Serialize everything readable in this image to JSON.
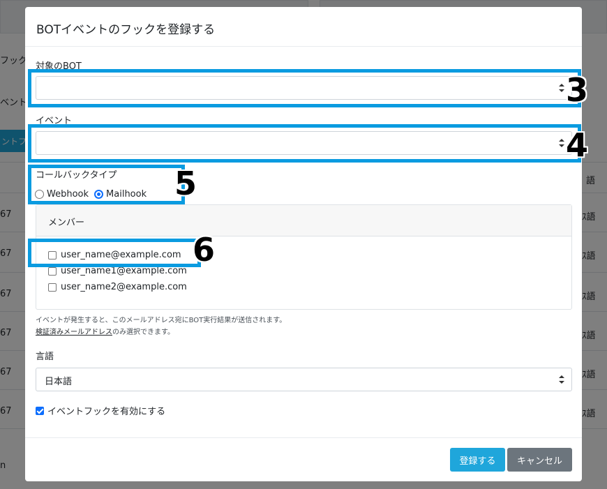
{
  "background": {
    "left_fragments": [
      "フック",
      "ベント",
      "ントフ",
      "67",
      "67",
      "67",
      "67",
      "67",
      "67",
      "n"
    ],
    "right_fragments": [
      "語",
      "ｽ語",
      "ｽ語",
      "ｽ語",
      "ｽ語",
      "ｽ語",
      "ｽ語"
    ]
  },
  "modal": {
    "title": "BOTイベントのフックを登録する",
    "target_bot_label": "対象のBOT",
    "target_bot_value": "",
    "event_label": "イベント",
    "event_value": "",
    "callback_type_label": "コールバックタイプ",
    "callback_options": [
      {
        "label": "Webhook",
        "selected": false
      },
      {
        "label": "Mailhook",
        "selected": true
      }
    ],
    "members_header": "メンバー",
    "members": [
      {
        "email": "user_name@example.com",
        "checked": false
      },
      {
        "email": "user_name1@example.com",
        "checked": false
      },
      {
        "email": "user_name2@example.com",
        "checked": false
      }
    ],
    "help_line1": "イベントが発生すると、このメールアドレス宛にBOT実行結果が送信されます。",
    "help_link": "検証済みメールアドレス",
    "help_line2_suffix": "のみ選択できます。",
    "language_label": "言語",
    "language_value": "日本語",
    "enable_label": "イベントフックを有効にする",
    "enable_checked": true,
    "submit_label": "登録する",
    "cancel_label": "キャンセル"
  },
  "annotations": [
    "3",
    "4",
    "5",
    "6"
  ],
  "colors": {
    "primary": "#1fa6db",
    "secondary": "#6c757d",
    "annotation": "#0a9be0",
    "checkbox": "#0d6efd"
  }
}
